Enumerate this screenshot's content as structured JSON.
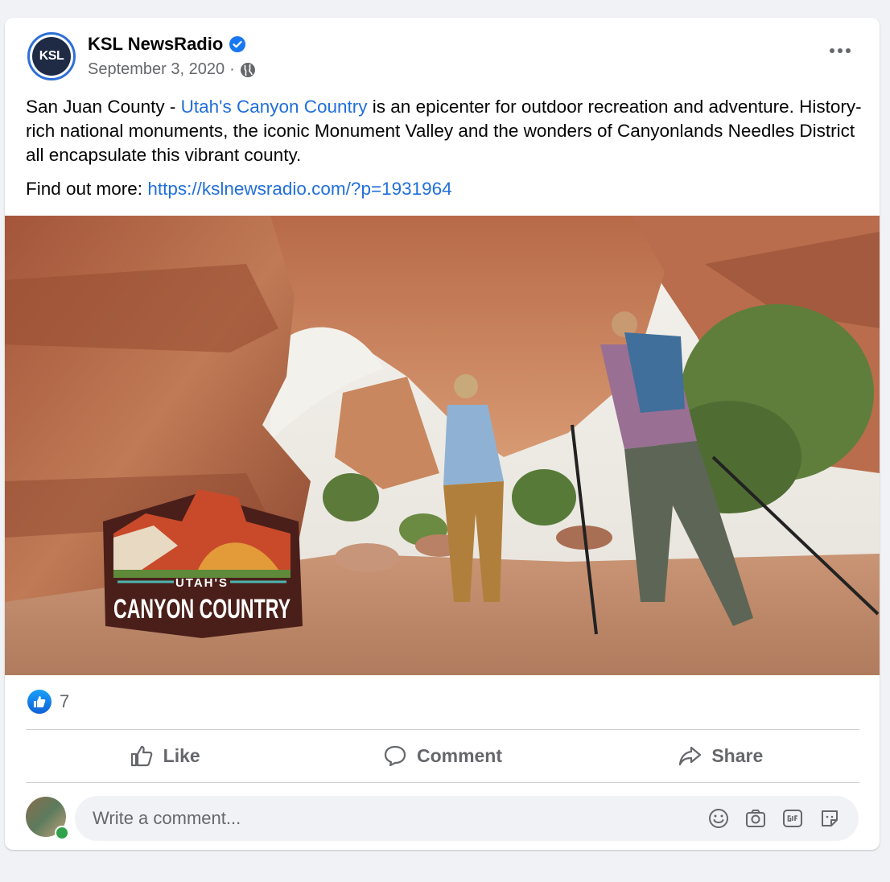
{
  "post": {
    "page_name": "KSL NewsRadio",
    "avatar_text": "KSL",
    "date": "September 3, 2020",
    "separator": "·",
    "text_prefix": "San Juan County - ",
    "text_link": "Utah's Canyon Country",
    "text_rest": " is an epicenter for outdoor recreation and adventure. History-rich national monuments, the iconic Monument Valley and the wonders of Canyonlands Needles District all encapsulate this vibrant county.",
    "find_more_label": "Find out more: ",
    "find_more_url": "https://kslnewsradio.com/?p=1931964"
  },
  "photo": {
    "logo_top": "UTAH'S",
    "logo_bottom": "CANYON COUNTRY"
  },
  "reactions": {
    "count": "7"
  },
  "actions": {
    "like": "Like",
    "comment": "Comment",
    "share": "Share"
  },
  "comment": {
    "placeholder": "Write a comment..."
  },
  "colors": {
    "link": "#216fdb",
    "verified": "#1877f2",
    "online": "#31a24c"
  }
}
